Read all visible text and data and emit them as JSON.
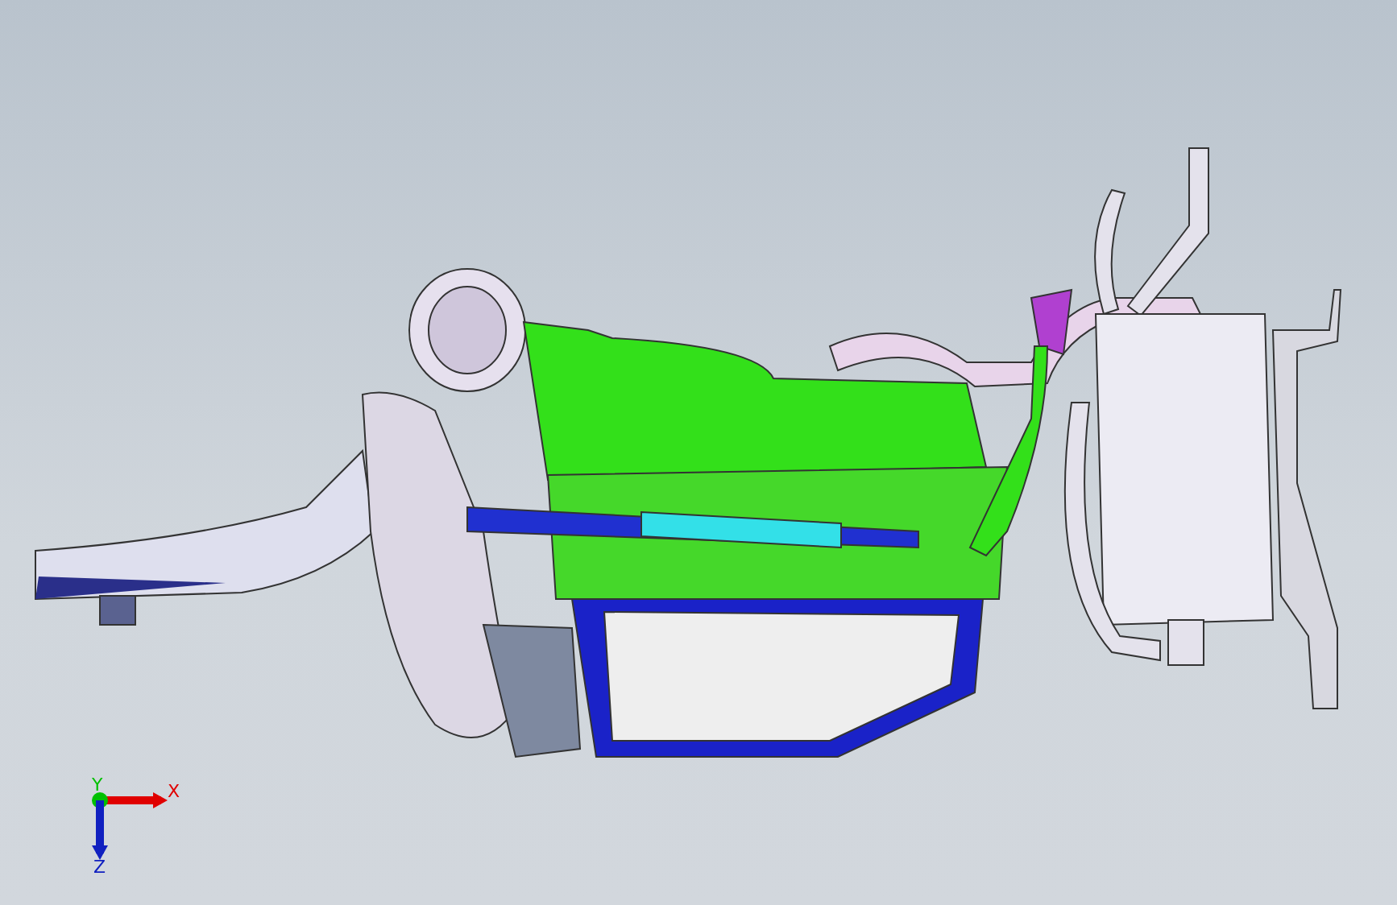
{
  "viewport": {
    "triad": {
      "axes": [
        {
          "label": "X",
          "kind": "x",
          "color": "#e00000"
        },
        {
          "label": "Y",
          "kind": "y",
          "color": "#00c000"
        },
        {
          "label": "Z",
          "kind": "z",
          "color": "#1020c0"
        }
      ]
    }
  }
}
